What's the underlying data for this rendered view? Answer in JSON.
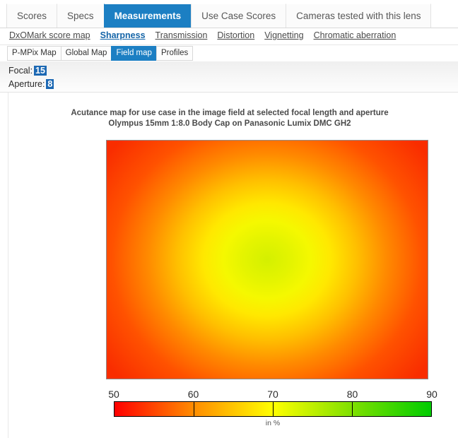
{
  "tabs": [
    {
      "label": "Scores",
      "active": false
    },
    {
      "label": "Specs",
      "active": false
    },
    {
      "label": "Measurements",
      "active": true
    },
    {
      "label": "Use Case Scores",
      "active": false
    },
    {
      "label": "Cameras tested with this lens",
      "active": false
    }
  ],
  "subnav": [
    {
      "label": "DxOMark score map",
      "active": false
    },
    {
      "label": "Sharpness",
      "active": true
    },
    {
      "label": "Transmission",
      "active": false
    },
    {
      "label": "Distortion",
      "active": false
    },
    {
      "label": "Vignetting",
      "active": false
    },
    {
      "label": "Chromatic aberration",
      "active": false
    }
  ],
  "minitabs": [
    {
      "label": "P-MPix Map",
      "active": false
    },
    {
      "label": "Global Map",
      "active": false
    },
    {
      "label": "Field map",
      "active": true
    },
    {
      "label": "Profiles",
      "active": false
    }
  ],
  "params": {
    "focal_label": "Focal:",
    "focal_value": "15",
    "aperture_label": "Aperture:",
    "aperture_value": "8"
  },
  "colors": {
    "accent_blue": "#1c7fc3",
    "param_blue": "#1c68b3",
    "link_active": "#1565a8",
    "scale_min": "#ff0000",
    "scale_mid": "#ffff00",
    "scale_max": "#00cc00",
    "center": "#d4f000",
    "corner": "#f92d00"
  },
  "chart_data": {
    "type": "heatmap",
    "title": "Acutance map for use case in the image field at selected focal length and aperture",
    "subtitle": "Olympus 15mm 1:8.0 Body Cap on Panasonic Lumix DMC GH2",
    "unit_label": "in %",
    "colorbar": {
      "min": 50,
      "max": 90,
      "ticks": [
        50,
        60,
        70,
        80,
        90
      ],
      "stops": [
        {
          "value": 50,
          "color": "#ff0000"
        },
        {
          "value": 60,
          "color": "#ff8c00"
        },
        {
          "value": 70,
          "color": "#ffff00"
        },
        {
          "value": 80,
          "color": "#7fe000"
        },
        {
          "value": 90,
          "color": "#00cc00"
        }
      ]
    },
    "field": {
      "description": "Radially symmetric acutance falloff, peak at image centre",
      "center_value": 72,
      "corner_value": 52,
      "edge_mid_value": 56,
      "radial_profile": [
        {
          "radius_pct": 0,
          "value": 72,
          "color": "#d4f000"
        },
        {
          "radius_pct": 12,
          "value": 71,
          "color": "#e4f400"
        },
        {
          "radius_pct": 22,
          "value": 70,
          "color": "#f5f800"
        },
        {
          "radius_pct": 32,
          "value": 68,
          "color": "#ffe800"
        },
        {
          "radius_pct": 45,
          "value": 64,
          "color": "#ffc000"
        },
        {
          "radius_pct": 60,
          "value": 60,
          "color": "#ff8a00"
        },
        {
          "radius_pct": 78,
          "value": 56,
          "color": "#ff5200"
        },
        {
          "radius_pct": 100,
          "value": 52,
          "color": "#f92d00"
        }
      ]
    }
  }
}
